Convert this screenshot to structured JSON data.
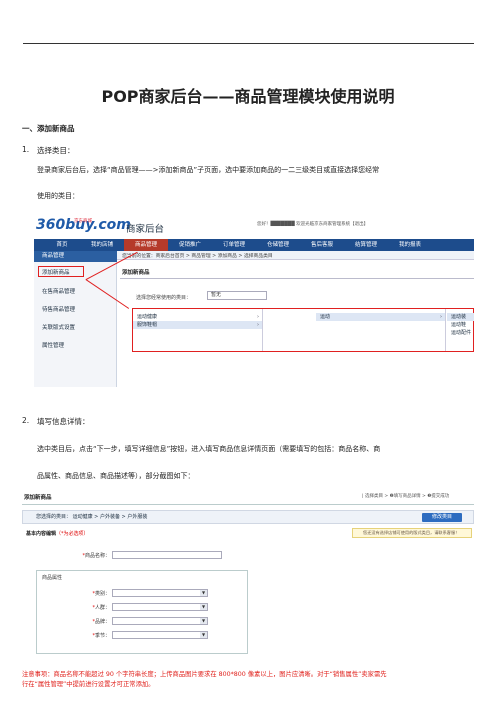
{
  "doc": {
    "title": "POP商家后台——商品管理模块使用说明",
    "section1": "一、添加新商品",
    "step1": {
      "num": "1.",
      "label": "选择类目：",
      "text_line1": "登录商家后台后，选择“商品管理——>添加新商品”子页面，选中要添加商品的一二三级类目或直接选择您经常",
      "text_line2": "使用的类目："
    },
    "step2": {
      "num": "2.",
      "label": "填写信息详情：",
      "text_line1": "选中类目后，点击“下一步，填写详细信息”按钮，进入填写商品信息详情页面（需要填写的包括：商品名称、商",
      "text_line2": "品属性、商品信息、商品描述等），部分截图如下："
    },
    "note_line1": "注意事项：商品名称不能超过 90 个字符串长度；上传商品图片要求在 800*800 像素以上，图片应清晰。对于“销售属性”卖家需先",
    "note_line2": "行在“属性管理”中提前进行设置才可正常添加。"
  },
  "screenshot1": {
    "logo": "360buy.com",
    "logo_sub": "京东商城",
    "brand": "商家后台",
    "userbar": "您好！███████  欢迎光临京东商家管理系统【退出】",
    "nav": [
      "首页",
      "我的店铺",
      "商品管理",
      "促销推广",
      "订单管理",
      "仓储管理",
      "售后客服",
      "结算管理",
      "我的报表"
    ],
    "active_nav": "商品管理",
    "sidebar_head": "商品管理",
    "sidebar_items": [
      "添加新商品",
      "在售商品管理",
      "待售商品管理",
      "关联版式设置",
      "属性管理"
    ],
    "crumb": "您当前的位置：商家后台首页  >  商品管理  >  添加商品  >  选择商品类目",
    "panel_title": "添加新商品",
    "pick_label": "选择您经常使用的类目：",
    "pick_value": "暂无",
    "col1": [
      "运动健康",
      "服饰鞋帽"
    ],
    "col2": [
      "运动"
    ],
    "col3": [
      "运动装",
      "运动鞋",
      "运动配件"
    ]
  },
  "screenshot2": {
    "title": "添加新商品",
    "steps": "| 选择类目  >  ❷填写商品详情  >  ❸提交成功",
    "catpath": "您选择的类目：  运动健康  >  户外装备  >  户外服装",
    "change_btn": "修改类目",
    "basic": "基本内容编辑",
    "basic_req": "（*为必选项）",
    "warn": "您还没有选择店铺可使用的版式类目，请联系客服！",
    "name_label": "商品名称：",
    "group_title": "商品属性",
    "fields": [
      "类别：",
      "人群：",
      "品牌：",
      "季节："
    ]
  }
}
